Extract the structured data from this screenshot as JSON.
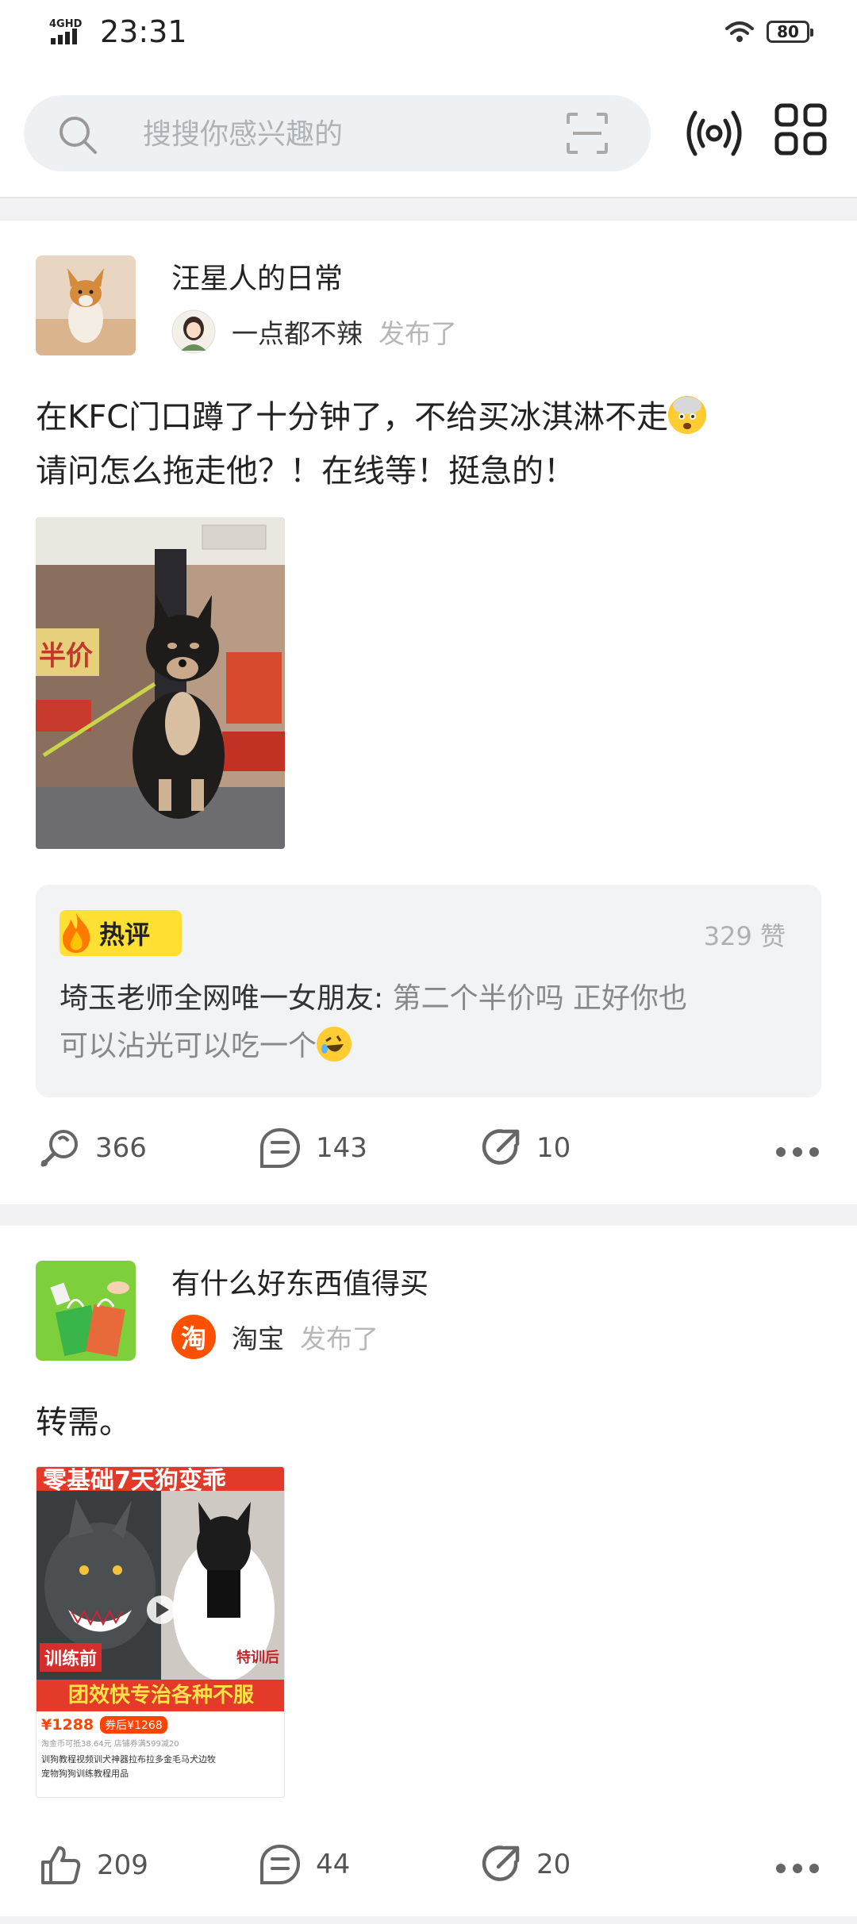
{
  "status_bar": {
    "network": "4GHD",
    "time": "23:31",
    "battery": "80"
  },
  "header": {
    "search_placeholder": "搜搜你感兴趣的"
  },
  "posts": [
    {
      "channel": "汪星人的日常",
      "author": "一点都不辣",
      "published": "发布了",
      "text_line1": "在KFC门口蹲了十分钟了，不给买冰淇淋不走",
      "text_line2": "请问怎么拖走他？！在线等！挺急的！",
      "hot_comment": {
        "tag": "热评",
        "likes": "329 赞",
        "user": "埼玉老师全网唯一女朋友:",
        "line1": "第二个半价吗 正好你也",
        "line2": "可以沾光可以吃一个"
      },
      "actions": {
        "likes": "366",
        "comments": "143",
        "shares": "10"
      }
    },
    {
      "channel": "有什么好东西值得买",
      "author": "淘宝",
      "author_icon_char": "淘",
      "published": "发布了",
      "text": "转需。",
      "image": {
        "headline": "零基础7天狗变乖",
        "before_label": "训练前",
        "after_label": "特训后",
        "banner": "团效快专治各种不服",
        "price1": "¥1288",
        "price2_tag": "券后¥1268",
        "coupon_line": "淘金币可抵38.64元   店铺券满599减20",
        "desc1": "训狗教程视频训犬神器拉布拉多金毛马犬边牧",
        "desc2": "宠物狗狗训练教程用品"
      },
      "actions": {
        "likes": "209",
        "comments": "44",
        "shares": "20"
      }
    }
  ],
  "colors": {
    "hot_tag": "#ffe033",
    "taobao": "#ff5000",
    "background": "#f2f2f4"
  }
}
